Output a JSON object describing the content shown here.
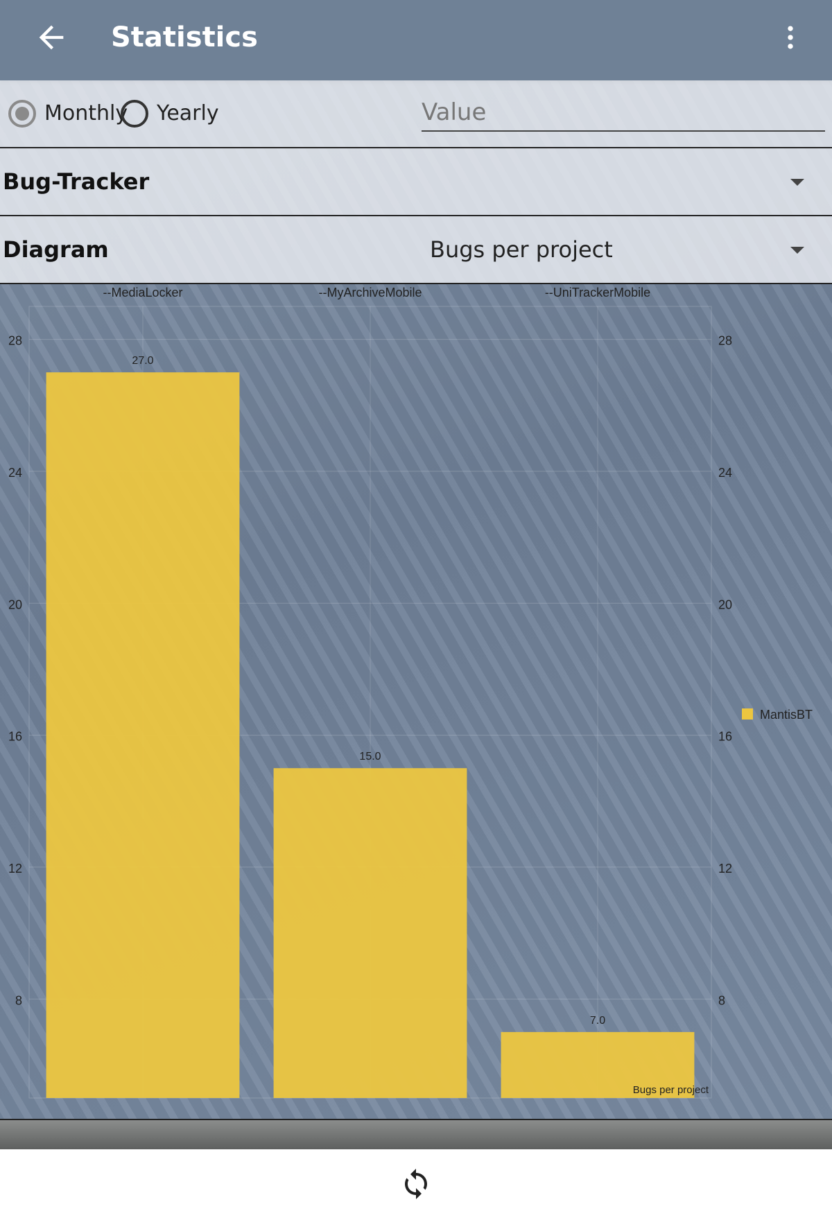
{
  "app_bar": {
    "title": "Statistics"
  },
  "period": {
    "monthly_label": "Monthly",
    "yearly_label": "Yearly",
    "selected": "Monthly"
  },
  "value_field": {
    "placeholder": "Value",
    "value": ""
  },
  "bug_tracker": {
    "label": "Bug-Tracker",
    "selected": ""
  },
  "diagram": {
    "label": "Diagram",
    "selected": "Bugs per project"
  },
  "chart_data": {
    "type": "bar",
    "categories": [
      "--MediaLocker",
      "--MyArchiveMobile",
      "--UniTrackerMobile"
    ],
    "series": [
      {
        "name": "MantisBT",
        "values": [
          27.0,
          15.0,
          7.0
        ],
        "color": "#ecc640"
      }
    ],
    "value_labels": [
      "27.0",
      "15.0",
      "7.0"
    ],
    "ylim": [
      5,
      29
    ],
    "yticks": [
      8,
      12,
      16,
      20,
      24,
      28
    ],
    "dual_y_axis": true,
    "grid": true,
    "legend": "right",
    "description": "Bugs per project"
  },
  "colors": {
    "app_bar": "#6f8196",
    "bar": "#ecc640"
  },
  "icons": {
    "back": "arrow-left-icon",
    "more": "more-vert-icon",
    "refresh": "refresh-icon"
  }
}
